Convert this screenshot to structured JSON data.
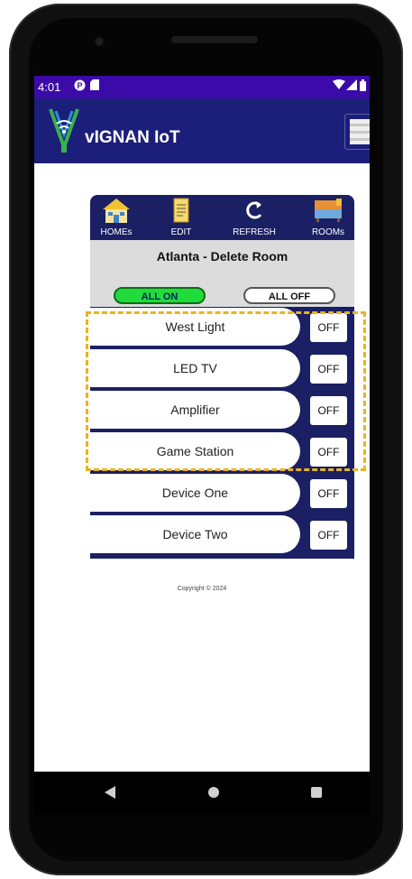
{
  "status_bar": {
    "time": "4:01",
    "left_icons": [
      "p-icon",
      "sd-card-icon"
    ],
    "right_icons": [
      "wifi-icon",
      "signal-icon",
      "battery-icon"
    ]
  },
  "app_bar": {
    "title": "vIGNAN IoT",
    "menu_icon": "hamburger-menu-icon"
  },
  "toolbar": {
    "items": [
      {
        "label": "HOMEs",
        "icon": "house-icon"
      },
      {
        "label": "EDIT",
        "icon": "edit-note-icon"
      },
      {
        "label": "REFRESH",
        "icon": "refresh-icon"
      },
      {
        "label": "ROOMs",
        "icon": "rooms-icon"
      }
    ]
  },
  "room": {
    "title": "Atlanta - Delete Room",
    "all_on_label": "ALL ON",
    "all_off_label": "ALL OFF"
  },
  "devices": [
    {
      "name": "West Light",
      "state": "OFF"
    },
    {
      "name": "LED TV",
      "state": "OFF"
    },
    {
      "name": "Amplifier",
      "state": "OFF"
    },
    {
      "name": "Game Station",
      "state": "OFF"
    },
    {
      "name": "Device One",
      "state": "OFF"
    },
    {
      "name": "Device Two",
      "state": "OFF"
    }
  ],
  "footer": {
    "copyright": "Copyright © 2024"
  },
  "colors": {
    "status_bar": "#3b0aa8",
    "app_bar": "#1b1f7a",
    "panel": "#1b1f63",
    "all_on": "#1fdc3a",
    "highlight": "#e8b41f"
  }
}
